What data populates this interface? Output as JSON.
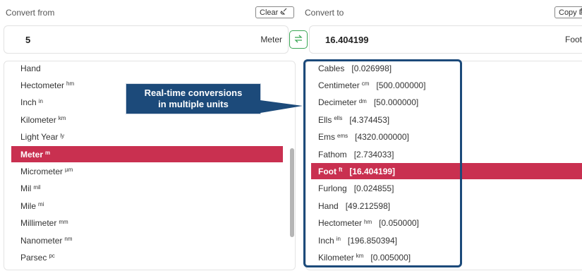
{
  "from_panel": {
    "label": "Convert from",
    "clear_label": "Clear",
    "value": "5",
    "unit": "Meter",
    "items": [
      {
        "name": "Hand",
        "sup": ""
      },
      {
        "name": "Hectometer",
        "sup": "hm"
      },
      {
        "name": "Inch",
        "sup": "in"
      },
      {
        "name": "Kilometer",
        "sup": "km"
      },
      {
        "name": "Light Year",
        "sup": "ly"
      },
      {
        "name": "Meter",
        "sup": "m",
        "selected": true
      },
      {
        "name": "Micrometer",
        "sup": "µm"
      },
      {
        "name": "Mil",
        "sup": "mil"
      },
      {
        "name": "Mile",
        "sup": "mi"
      },
      {
        "name": "Millimeter",
        "sup": "mm"
      },
      {
        "name": "Nanometer",
        "sup": "nm"
      },
      {
        "name": "Parsec",
        "sup": "pc"
      }
    ]
  },
  "to_panel": {
    "label": "Convert to",
    "copy_label": "Copy",
    "value": "16.404199",
    "unit": "Foot",
    "items": [
      {
        "name": "Cables",
        "sup": "",
        "value": "[0.026998]"
      },
      {
        "name": "Centimeter",
        "sup": "cm",
        "value": "[500.000000]"
      },
      {
        "name": "Decimeter",
        "sup": "dm",
        "value": "[50.000000]"
      },
      {
        "name": "Ells",
        "sup": "ells",
        "value": "[4.374453]"
      },
      {
        "name": "Ems",
        "sup": "ems",
        "value": "[4320.000000]"
      },
      {
        "name": "Fathom",
        "sup": "",
        "value": "[2.734033]"
      },
      {
        "name": "Foot",
        "sup": "ft",
        "value": "[16.404199]",
        "selected": true
      },
      {
        "name": "Furlong",
        "sup": "",
        "value": "[0.024855]"
      },
      {
        "name": "Hand",
        "sup": "",
        "value": "[49.212598]"
      },
      {
        "name": "Hectometer",
        "sup": "hm",
        "value": "[0.050000]"
      },
      {
        "name": "Inch",
        "sup": "in",
        "value": "[196.850394]"
      },
      {
        "name": "Kilometer",
        "sup": "km",
        "value": "[0.005000]"
      }
    ]
  },
  "callout": {
    "line1": "Real-time conversions",
    "line2": "in multiple units"
  },
  "icons": {
    "clear": "broom-icon",
    "copy": "copy-icon",
    "swap": "swap-arrows-icon"
  },
  "colors": {
    "selected": "#c93050",
    "callout": "#1c4a7a",
    "swap_accent": "#3aa655"
  }
}
